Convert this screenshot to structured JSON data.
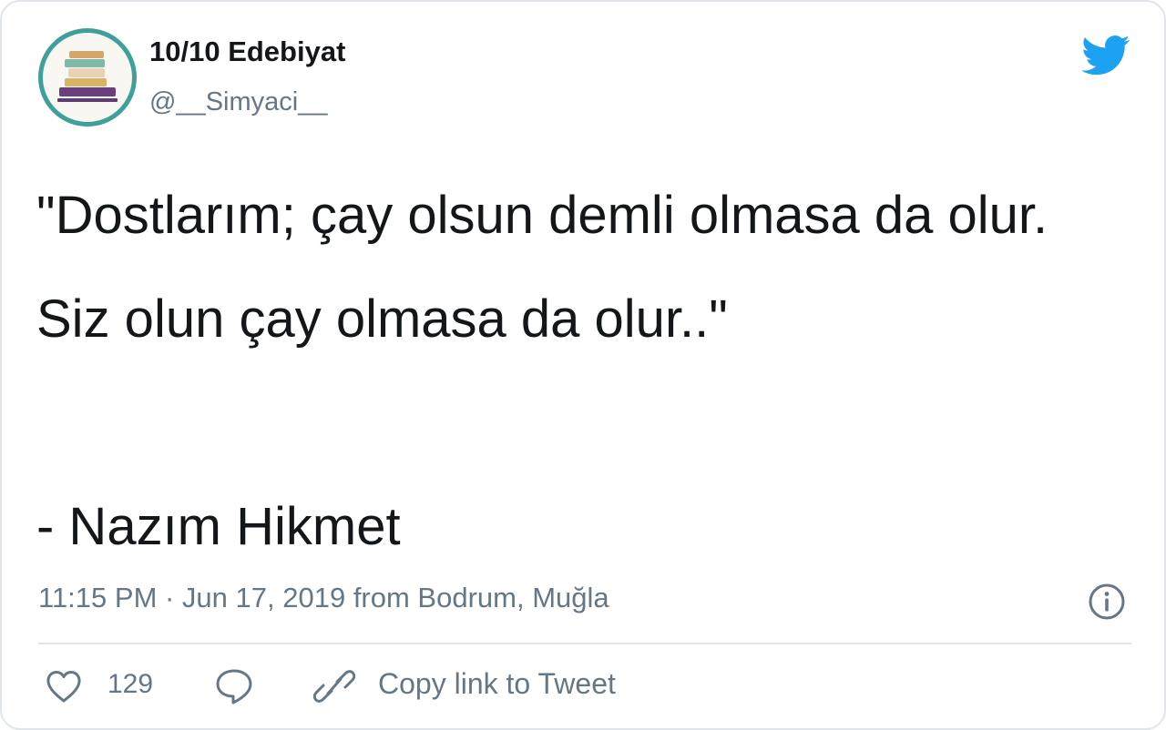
{
  "author": {
    "display_name": "10/10 Edebiyat",
    "handle": "@__Simyaci__",
    "avatar_icon": "stacked-books-icon"
  },
  "brand": {
    "icon": "twitter-bird-icon",
    "color": "#1da1f2"
  },
  "tweet": {
    "text": "\"Dostlarım; çay olsun demli olmasa da olur. Siz olun çay olmasa da olur..\"\n\n- Nazım Hikmet",
    "metadata": "11:15 PM · Jun 17, 2019 from Bodrum, Muğla"
  },
  "actions": {
    "like_icon": "heart-icon",
    "like_count": "129",
    "reply_icon": "reply-bubble-icon",
    "copy_link_icon": "link-icon",
    "copy_link_label": "Copy link to Tweet",
    "info_icon": "info-icon"
  },
  "colors": {
    "text_primary": "#14171a",
    "text_secondary": "#657786",
    "border": "#dfe5ea",
    "avatar_ring": "#3f9f9a"
  }
}
